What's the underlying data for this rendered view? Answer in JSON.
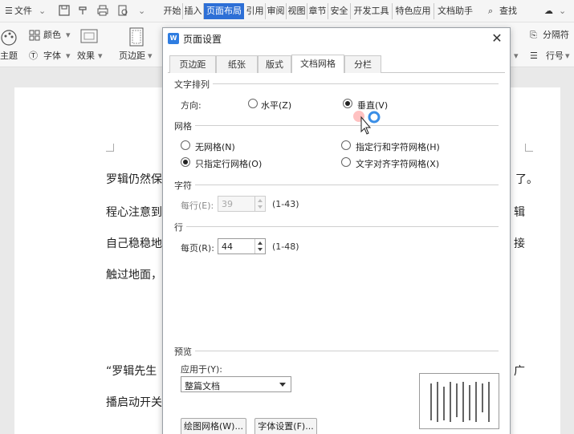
{
  "menubar": {
    "file_label": "文件",
    "tabs": [
      "开始",
      "插入",
      "页面布局",
      "引用",
      "审阅",
      "视图",
      "章节",
      "安全",
      "开发工具",
      "特色应用",
      "文档助手"
    ],
    "active_tab": "页面布局",
    "search_label": "查找"
  },
  "ribbon": {
    "color_label": "颜色",
    "theme_label": "主题",
    "font_label": "字体",
    "effect_label": "效果",
    "margin_label": "页边距",
    "separator_label": "分隔符",
    "line_number_label": "行号"
  },
  "document": {
    "lines": [
      "罗辑仍然保",
      "程心注意到",
      "自己稳稳地",
      "触过地面，",
      "“罗辑先生",
      "播启动开关"
    ],
    "right_fragments": [
      "了。",
      "辑",
      "接",
      "广"
    ]
  },
  "dialog": {
    "title": "页面设置",
    "tabs": [
      "页边距",
      "纸张",
      "版式",
      "文档网格",
      "分栏"
    ],
    "active_tab": "文档网格",
    "text_direction": {
      "section_label": "文字排列",
      "direction_label": "方向:",
      "options": [
        "水平(Z)",
        "垂直(V)"
      ],
      "selected": "垂直(V)"
    },
    "grid": {
      "section_label": "网格",
      "options": [
        "无网格(N)",
        "指定行和字符网格(H)",
        "只指定行网格(O)",
        "文字对齐字符网格(X)"
      ],
      "selected": "只指定行网格(O)"
    },
    "characters": {
      "section_label": "字符",
      "per_line_label": "每行(E):",
      "per_line_value": "39",
      "per_line_range": "(1-43)"
    },
    "lines": {
      "section_label": "行",
      "per_page_label": "每页(R):",
      "per_page_value": "44",
      "per_page_range": "(1-48)"
    },
    "preview": {
      "section_label": "预览",
      "apply_to_label": "应用于(Y):",
      "apply_to_value": "整篇文档"
    },
    "buttons": {
      "drawing_grid": "绘图网格(W)...",
      "font_settings": "字体设置(F)..."
    }
  },
  "colors": {
    "active_tab": "#2d6fd6",
    "radio_selected": "#222222",
    "click_indicator": "#3a8ee6"
  }
}
